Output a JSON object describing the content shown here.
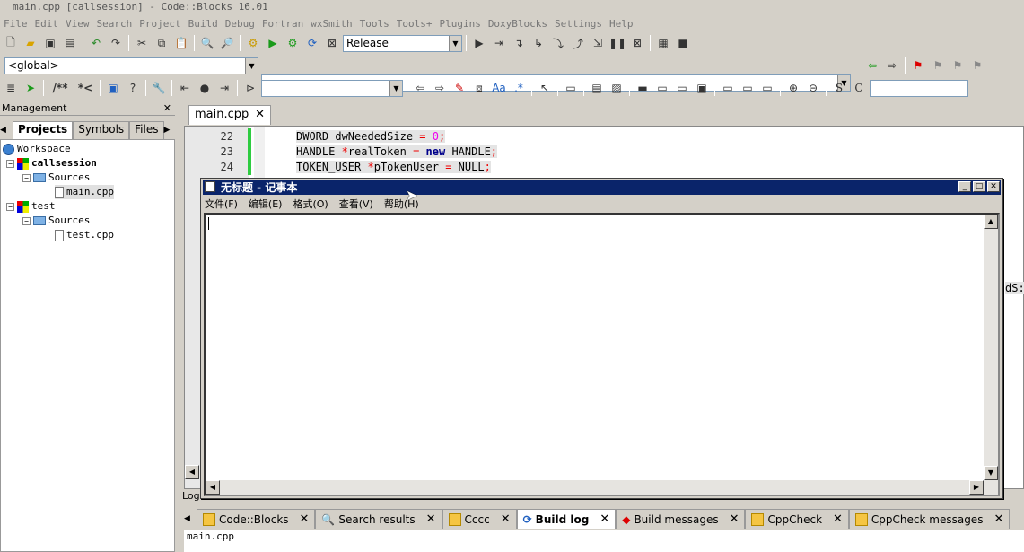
{
  "window": {
    "title": "main.cpp [callsession] - Code::Blocks 16.01"
  },
  "menubar": [
    "File",
    "Edit",
    "View",
    "Search",
    "Project",
    "Build",
    "Debug",
    "Fortran",
    "wxSmith",
    "Tools",
    "Tools+",
    "Plugins",
    "DoxyBlocks",
    "Settings",
    "Help"
  ],
  "toolbar": {
    "build_target": "Release",
    "scope": "<global>",
    "symbol": "",
    "comment_a": "/**",
    "comment_b": "*<"
  },
  "management": {
    "title": "Management",
    "close": "✕",
    "tabs": [
      "Projects",
      "Symbols",
      "Files"
    ],
    "tree": {
      "workspace": "Workspace",
      "project1": "callsession",
      "sources1": "Sources",
      "file1": "main.cpp",
      "project2": "test",
      "sources2": "Sources",
      "file2": "test.cpp"
    }
  },
  "editor": {
    "tab_label": "main.cpp",
    "lines": [
      {
        "num": "22"
      },
      {
        "num": "23"
      },
      {
        "num": "24"
      }
    ],
    "overflow_text": "dS:"
  },
  "notepad": {
    "title": "无标题 - 记事本",
    "menu": [
      "文件(F)",
      "编辑(E)",
      "格式(O)",
      "查看(V)",
      "帮助(H)"
    ]
  },
  "log": {
    "header": "Log",
    "tabs": [
      "Code::Blocks",
      "Search results",
      "Cccc",
      "Build log",
      "Build messages",
      "CppCheck",
      "CppCheck messages"
    ],
    "active_tab": "Build log",
    "first_line": "main.cpp"
  },
  "colors": {
    "notepad_title_bg": "#0a246a",
    "keyword": "#00008b",
    "operator": "#e00",
    "number": "#ef00ef",
    "changebar": "#2ecc40"
  }
}
